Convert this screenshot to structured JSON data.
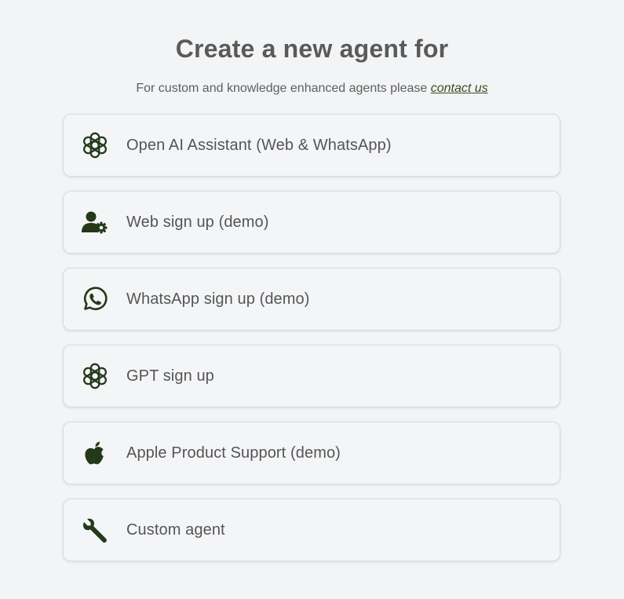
{
  "header": {
    "title": "Create a new agent for",
    "subtitle_prefix": "For custom and knowledge enhanced agents please ",
    "contact_link": "contact us"
  },
  "colors": {
    "icon": "#24381a",
    "background": "#f3f4f6",
    "card": "#f4f5f7"
  },
  "options": [
    {
      "label": "Open AI Assistant (Web & WhatsApp)",
      "icon": "openai-icon"
    },
    {
      "label": "Web sign up (demo)",
      "icon": "user-gear-icon"
    },
    {
      "label": "WhatsApp sign up (demo)",
      "icon": "whatsapp-icon"
    },
    {
      "label": "GPT sign up",
      "icon": "openai-icon"
    },
    {
      "label": "Apple Product Support (demo)",
      "icon": "apple-icon"
    },
    {
      "label": "Custom agent",
      "icon": "wrench-icon"
    }
  ]
}
